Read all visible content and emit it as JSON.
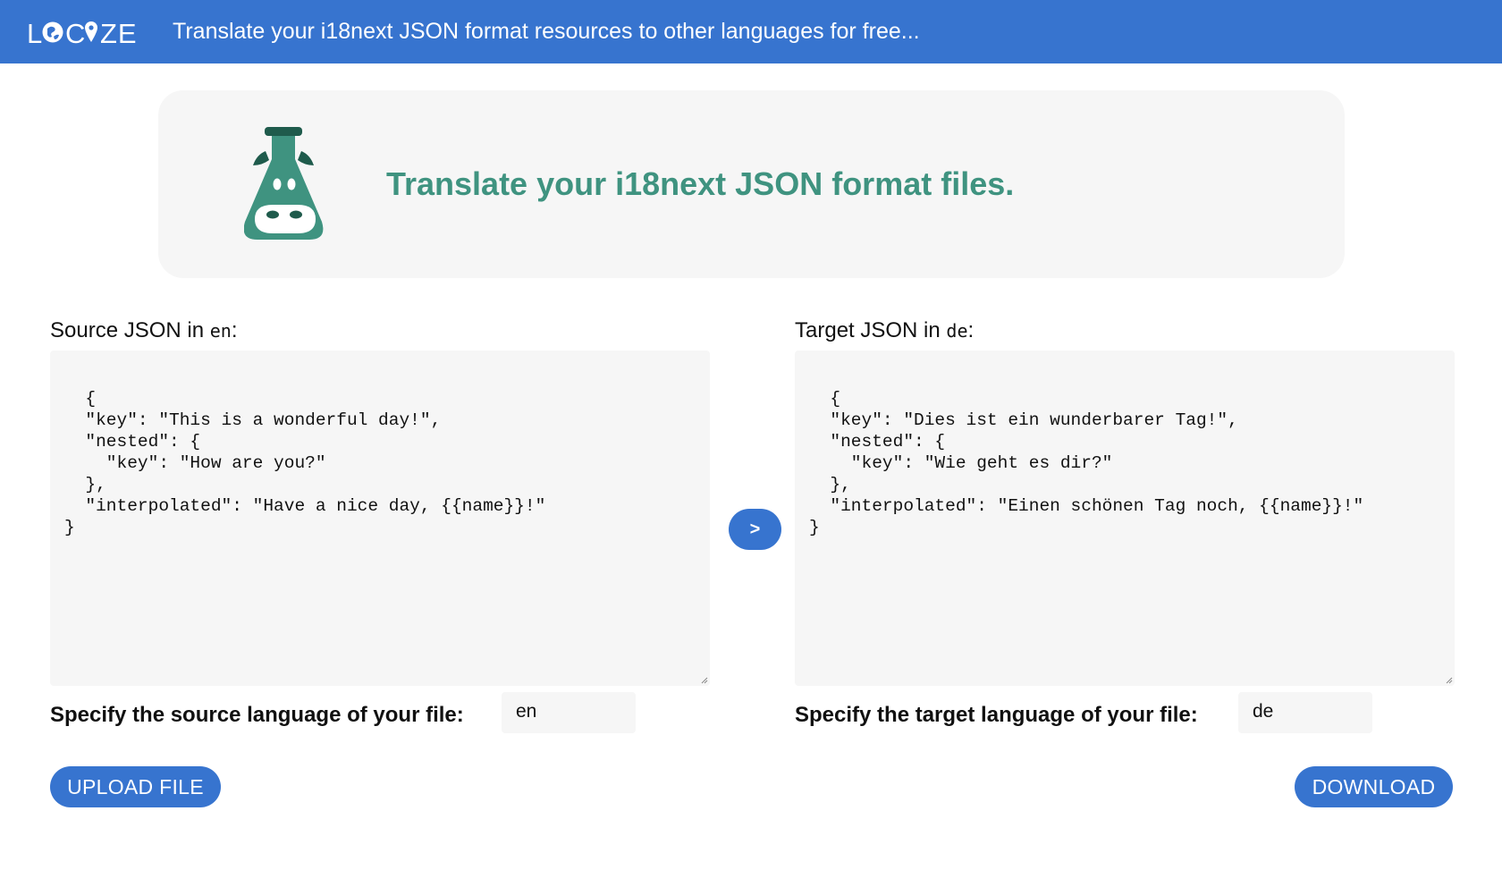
{
  "header": {
    "logo_text": "LOCIZE",
    "tagline": "Translate your i18next JSON format resources to other languages for free..."
  },
  "hero": {
    "icon": "flask-cow-icon",
    "title": "Translate your i18next JSON format files."
  },
  "source": {
    "label_prefix": "Source JSON in ",
    "lang_code": "en",
    "label_suffix": ":",
    "json": "{\n  \"key\": \"This is a wonderful day!\",\n  \"nested\": {\n    \"key\": \"How are you?\"\n  },\n  \"interpolated\": \"Have a nice day, {{name}}!\"\n}",
    "lang_field_label": "Specify the source language of your file:",
    "lang_field_value": "en",
    "upload_label": "UPLOAD FILE"
  },
  "target": {
    "label_prefix": "Target JSON in ",
    "lang_code": "de",
    "label_suffix": ":",
    "json": "{\n  \"key\": \"Dies ist ein wunderbarer Tag!\",\n  \"nested\": {\n    \"key\": \"Wie geht es dir?\"\n  },\n  \"interpolated\": \"Einen schönen Tag noch, {{name}}!\"\n}",
    "lang_field_label": "Specify the target language of your file:",
    "lang_field_value": "de",
    "download_label": "DOWNLOAD"
  },
  "translate_button": {
    "label": ">"
  },
  "colors": {
    "brand_blue": "#3774cf",
    "accent_green": "#3f9380",
    "panel_gray": "#f6f6f6"
  }
}
